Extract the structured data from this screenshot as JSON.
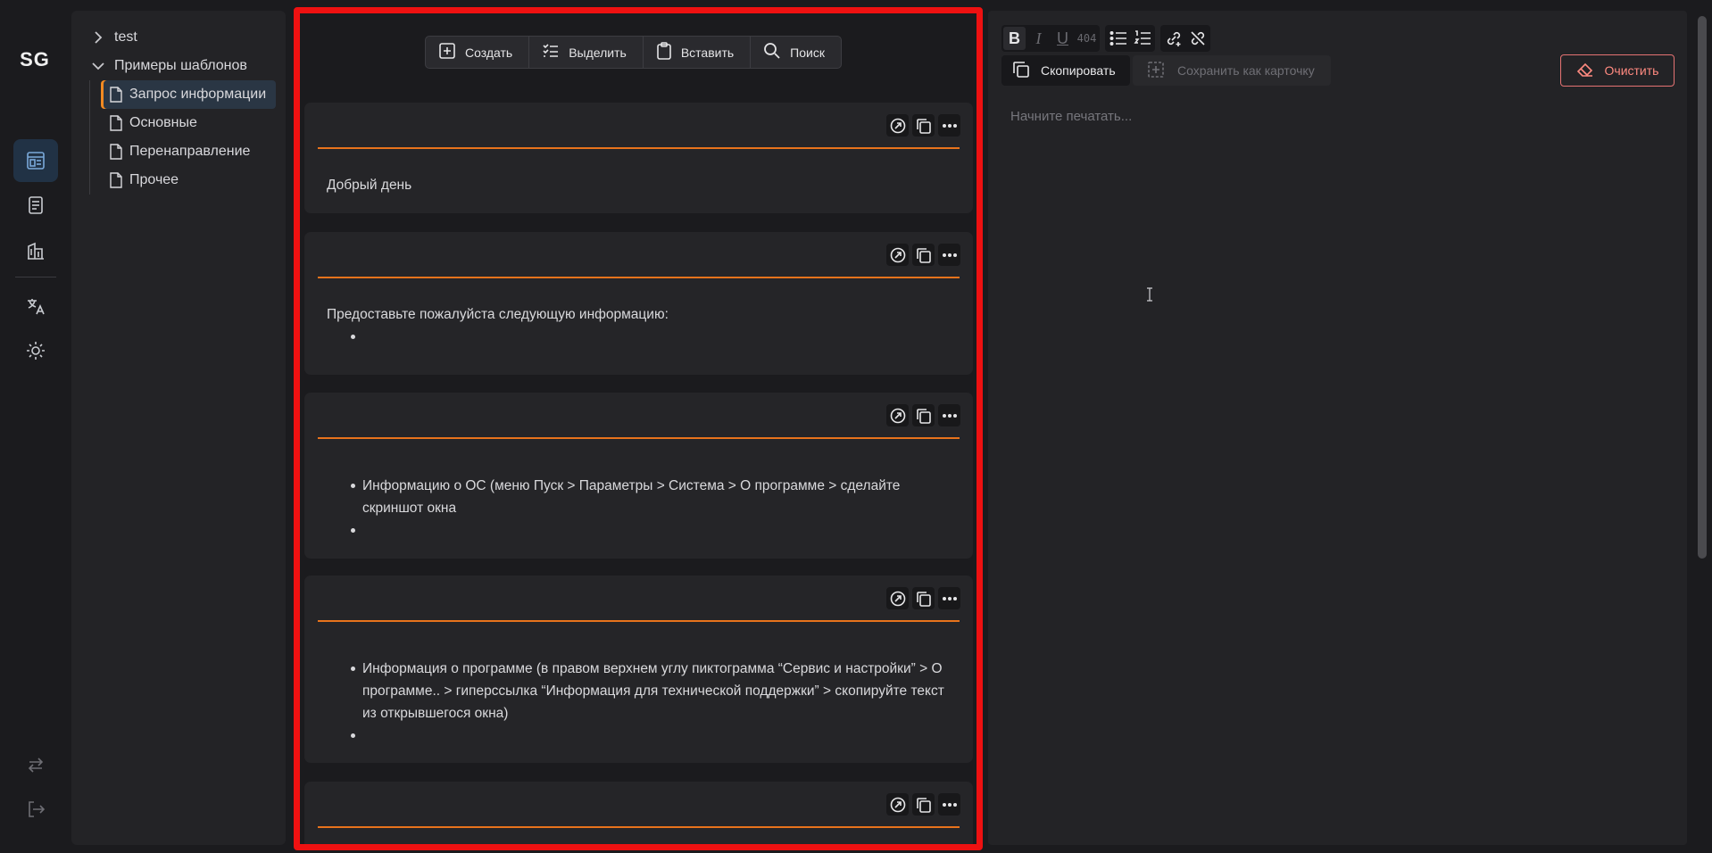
{
  "app": {
    "logo": "SG"
  },
  "rail": {
    "items": [
      {
        "icon": "templates-icon",
        "active": true
      },
      {
        "icon": "document-icon"
      },
      {
        "icon": "building-icon"
      },
      {
        "icon": "translate-icon"
      },
      {
        "icon": "sun-icon"
      },
      {
        "icon": "swap-icon"
      },
      {
        "icon": "logout-icon"
      }
    ]
  },
  "tree": {
    "root_items": [
      {
        "label": "test",
        "expanded": false
      },
      {
        "label": "Примеры шаблонов",
        "expanded": true
      }
    ],
    "children": [
      {
        "label": "Запрос информации",
        "selected": true
      },
      {
        "label": "Основные"
      },
      {
        "label": "Перенаправление"
      },
      {
        "label": "Прочее"
      }
    ]
  },
  "toolbar": {
    "create": "Создать",
    "select": "Выделить",
    "paste": "Вставить",
    "search": "Поиск"
  },
  "cards": [
    {
      "text": "Добрый день"
    },
    {
      "text": "Предоставьте пожалуйста следующую информацию:"
    },
    {
      "items": [
        "Информацию о ОС (меню Пуск > Параметры > Система > О программе > сделайте скриншот окна"
      ]
    },
    {
      "items": [
        "Информация о программе (в правом верхнем углу пиктограмма “Сервис и настройки” > О программе.. > гиперссылка “Информация для технической поддержки” > скопируйте текст из открывшегося окна)"
      ]
    }
  ],
  "editor": {
    "format": {
      "bold": "B",
      "italic": "I",
      "underline": "U",
      "code": "404"
    },
    "copy_label": "Скопировать",
    "save_card_label": "Сохранить как карточку",
    "clear_label": "Очистить",
    "placeholder": "Начните печатать..."
  },
  "colors": {
    "accent": "#e8731c",
    "highlight": "#ee1111",
    "danger": "#ff8a80",
    "active_rail": "#213245"
  }
}
